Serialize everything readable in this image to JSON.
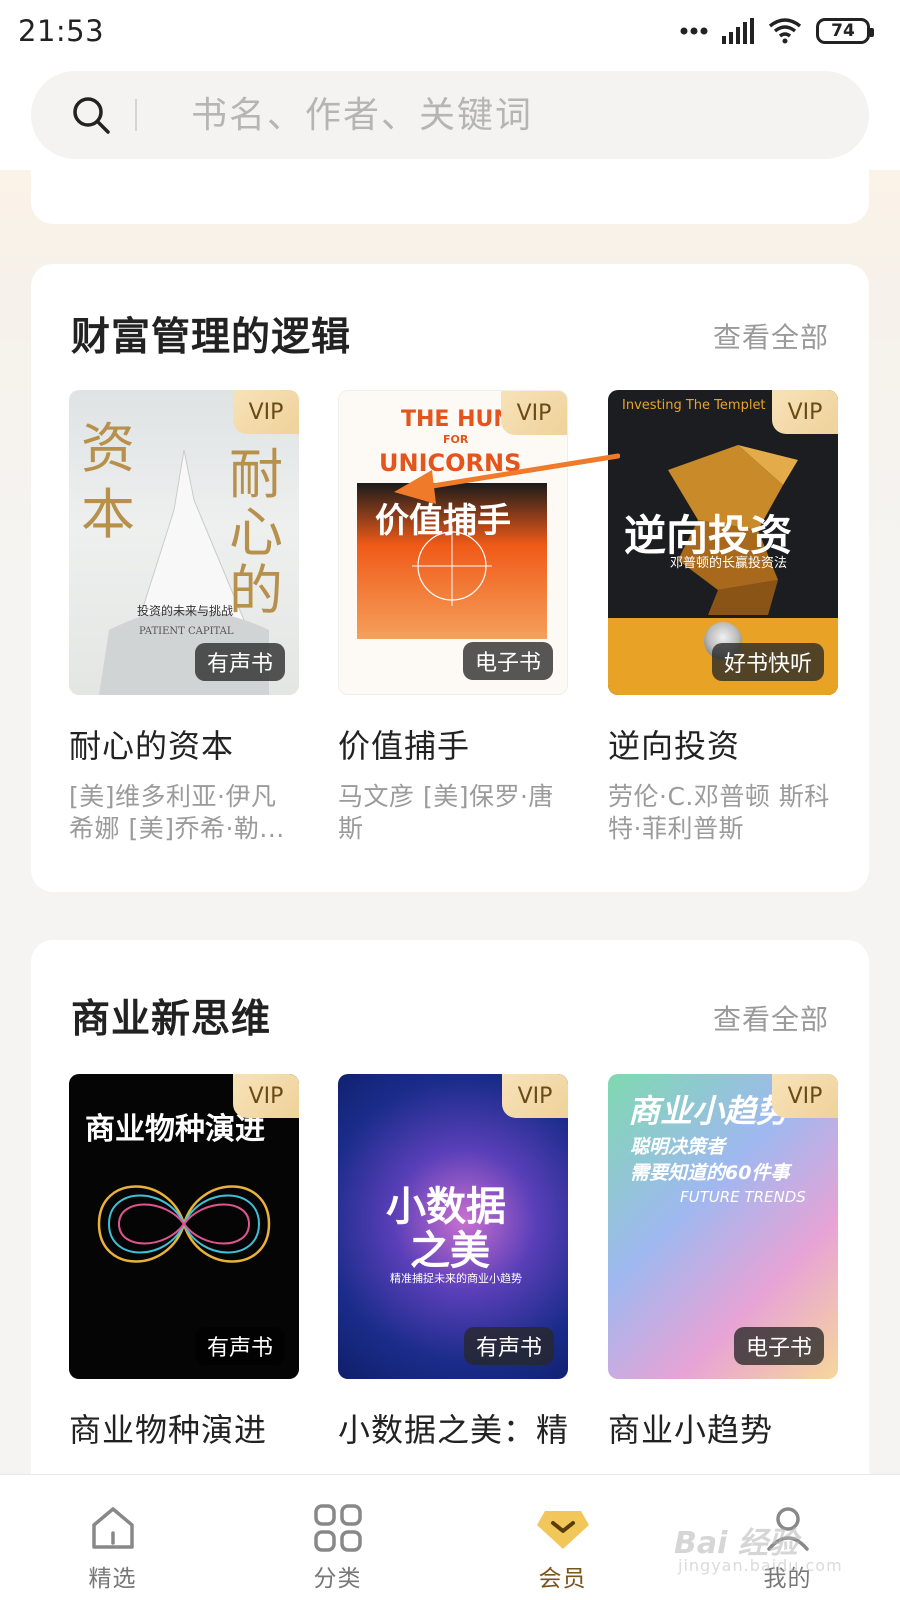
{
  "status_bar": {
    "time": "21:53",
    "battery": "74"
  },
  "search": {
    "placeholder": "书名、作者、关键词"
  },
  "sections": [
    {
      "title": "财富管理的逻辑",
      "see_all": "查看全部",
      "books": [
        {
          "title": "耐心的资本",
          "author": "[美]维多利亚·伊凡希娜 [美]乔希·勒...",
          "vip": "VIP",
          "type": "有声书",
          "cover": {
            "line1": "资",
            "line2": "本",
            "line3": "耐",
            "line4": "心",
            "line5": "的",
            "subtitle": "投资的未来与挑战",
            "english": "PATIENT CAPITAL"
          }
        },
        {
          "title": "价值捕手",
          "author": "马文彦 [美]保罗·唐斯",
          "vip": "VIP",
          "type": "电子书",
          "cover": {
            "en1": "THE HUNT",
            "en2": "FOR",
            "en3": "UNICORNS",
            "main": "价值捕手"
          }
        },
        {
          "title": "逆向投资",
          "author": "劳伦·C.邓普顿 斯科特·菲利普斯",
          "vip": "VIP",
          "type": "好书快听",
          "cover": {
            "top": "Investing The Templet",
            "main": "逆向投资",
            "sub": "邓普顿的长赢投资法"
          }
        }
      ]
    },
    {
      "title": "商业新思维",
      "see_all": "查看全部",
      "books": [
        {
          "title": "商业物种演进",
          "vip": "VIP",
          "type": "有声书",
          "cover": {
            "main": "商业物种演进"
          }
        },
        {
          "title": "小数据之美：精准捕捉未",
          "vip": "VIP",
          "type": "有声书",
          "cover": {
            "main1": "小数据",
            "main2": "之美",
            "sub": "精准捕捉未来的商业小趋势"
          }
        },
        {
          "title": "商业小趋势",
          "vip": "VIP",
          "type": "电子书",
          "cover": {
            "main": "商业小趋势",
            "sub1": "聪明决策者",
            "sub2": "需要知道的60件事",
            "english": "FUTURE TRENDS"
          }
        }
      ]
    }
  ],
  "tabs": [
    {
      "label": "精选",
      "icon": "home-icon"
    },
    {
      "label": "分类",
      "icon": "grid-icon"
    },
    {
      "label": "会员",
      "icon": "vip-diamond-icon",
      "active": true
    },
    {
      "label": "我的",
      "icon": "profile-icon"
    }
  ],
  "watermark": {
    "main": "Bai 经验",
    "sub": "jingyan.baidu.com"
  },
  "colors": {
    "accent": "#7a5519",
    "vip_gold": "#efd29b",
    "arrow": "#ef7a2a"
  }
}
